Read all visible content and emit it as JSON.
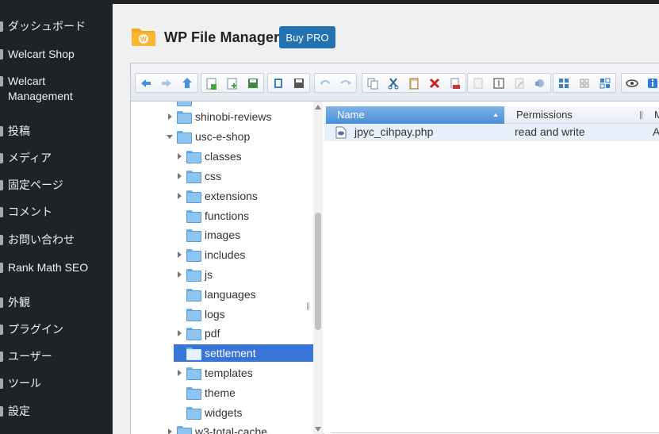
{
  "sidebar": {
    "items": [
      {
        "label": "ダッシュボード",
        "icon": "dashboard-icon"
      },
      {
        "label": "Welcart Shop",
        "icon": "cart-icon"
      },
      {
        "label": "Welcart Management",
        "icon": "cart-icon"
      },
      {
        "label": "投稿",
        "icon": "pin-icon"
      },
      {
        "label": "メディア",
        "icon": "media-icon"
      },
      {
        "label": "固定ページ",
        "icon": "page-icon"
      },
      {
        "label": "コメント",
        "icon": "comment-icon"
      },
      {
        "label": "お問い合わせ",
        "icon": "mail-icon"
      },
      {
        "label": "Rank Math SEO",
        "icon": "rankmath-icon"
      },
      {
        "label": "外観",
        "icon": "brush-icon"
      },
      {
        "label": "プラグイン",
        "icon": "plugin-icon"
      },
      {
        "label": "ユーザー",
        "icon": "user-icon"
      },
      {
        "label": "ツール",
        "icon": "wrench-icon"
      },
      {
        "label": "設定",
        "icon": "settings-icon"
      }
    ]
  },
  "header": {
    "title": "WP File Manager",
    "buy_pro": "Buy PRO",
    "logo_color": "#f5a623"
  },
  "tree": {
    "items": [
      {
        "label": "shinobi-reviews"
      },
      {
        "label": "usc-e-shop"
      },
      {
        "label": "classes"
      },
      {
        "label": "css"
      },
      {
        "label": "extensions"
      },
      {
        "label": "functions"
      },
      {
        "label": "images"
      },
      {
        "label": "includes"
      },
      {
        "label": "js"
      },
      {
        "label": "languages"
      },
      {
        "label": "logs"
      },
      {
        "label": "pdf"
      },
      {
        "label": "settlement"
      },
      {
        "label": "templates"
      },
      {
        "label": "theme"
      },
      {
        "label": "widgets"
      },
      {
        "label": "w3-total-cache"
      }
    ]
  },
  "list": {
    "columns": [
      "Name",
      "Permissions",
      "M"
    ],
    "files": [
      {
        "name": "jpyc_cihpay.php",
        "permissions": "read and write",
        "more": "A"
      }
    ]
  },
  "colors": {
    "accent": "#2271b1",
    "selected": "#3875d7",
    "sidebar_bg": "#1d2327"
  }
}
